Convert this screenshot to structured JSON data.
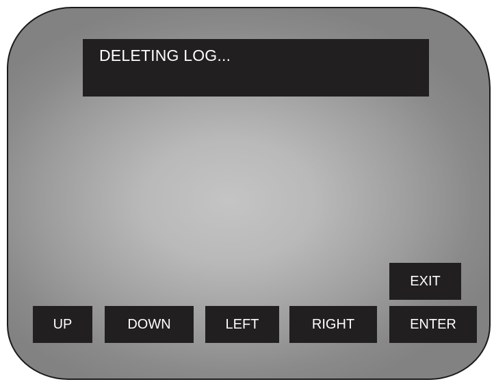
{
  "display": {
    "message": "DELETING LOG..."
  },
  "buttons": {
    "exit": "EXIT",
    "up": "UP",
    "down": "DOWN",
    "left": "LEFT",
    "right": "RIGHT",
    "enter": "ENTER"
  },
  "colors": {
    "panel_background": "#221f20",
    "text": "#ffffff",
    "screen_center": "#c4c4c4",
    "screen_edge": "#828282",
    "bezel_outline": "#1a1a1a"
  }
}
